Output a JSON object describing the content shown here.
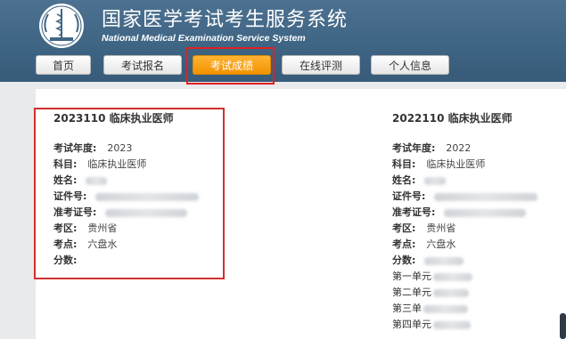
{
  "header": {
    "title_cn": "国家医学考试考生服务系统",
    "title_en": "National Medical Examination Service System"
  },
  "nav": [
    {
      "label": "首页",
      "active": false
    },
    {
      "label": "考试报名",
      "active": false
    },
    {
      "label": "考试成绩",
      "active": true
    },
    {
      "label": "在线评测",
      "active": false
    },
    {
      "label": "个人信息",
      "active": false
    }
  ],
  "colors": {
    "header_bg": "#3f6584",
    "active_tab": "#f29300",
    "highlight_box": "#e02020"
  },
  "cards": [
    {
      "title": "2023110  临床执业医师",
      "rows": [
        {
          "label": "考试年度:",
          "value": "2023"
        },
        {
          "label": "科目:",
          "value": "临床执业医师"
        },
        {
          "label": "姓名:",
          "value": ""
        },
        {
          "label": "证件号:",
          "value": ""
        },
        {
          "label": "准考证号:",
          "value": ""
        },
        {
          "label": "考区:",
          "value": "贵州省"
        },
        {
          "label": "考点:",
          "value": "六盘水"
        },
        {
          "label": "分数:",
          "value": ""
        }
      ]
    },
    {
      "title": "2022110  临床执业医师",
      "rows": [
        {
          "label": "考试年度:",
          "value": "2022"
        },
        {
          "label": "科目:",
          "value": "临床执业医师"
        },
        {
          "label": "姓名:",
          "value": ""
        },
        {
          "label": "证件号:",
          "value": ""
        },
        {
          "label": "准考证号:",
          "value": ""
        },
        {
          "label": "考区:",
          "value": "贵州省"
        },
        {
          "label": "考点:",
          "value": "六盘水"
        },
        {
          "label": "分数:",
          "value": ""
        },
        {
          "label": "第一单元",
          "value": ""
        },
        {
          "label": "第二单元",
          "value": ""
        },
        {
          "label": "第三单",
          "value": ""
        },
        {
          "label": "第四单元",
          "value": ""
        }
      ]
    }
  ]
}
